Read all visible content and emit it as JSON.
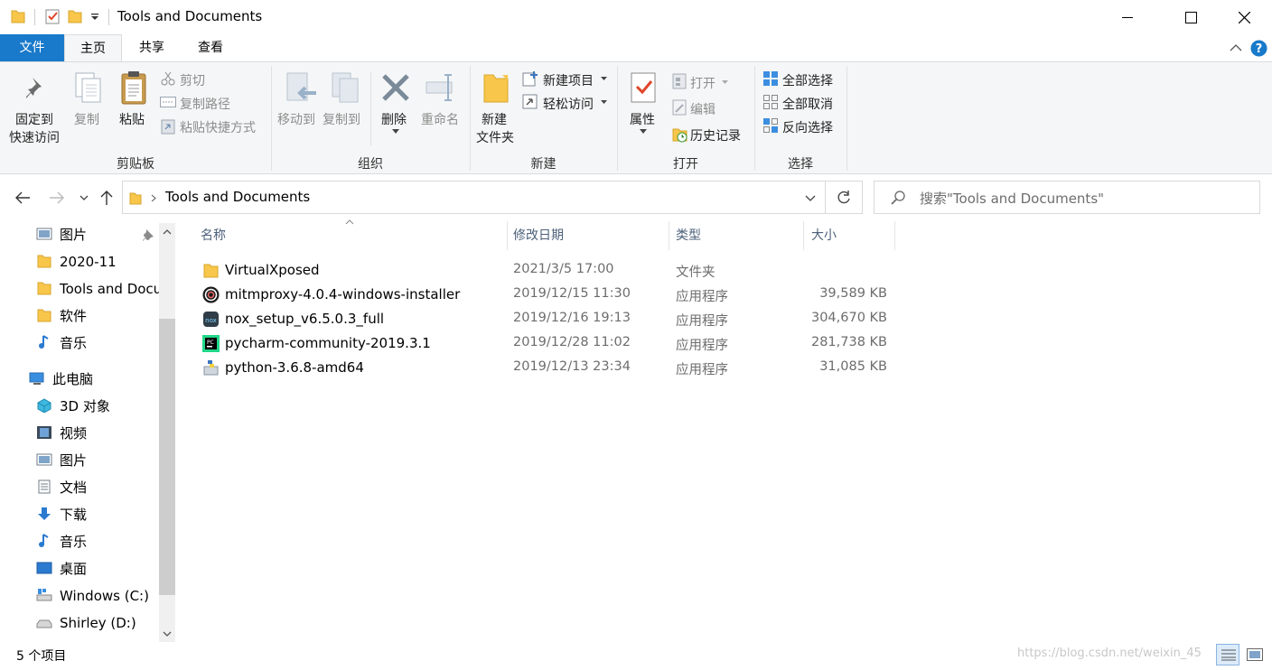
{
  "window": {
    "title": "Tools and Documents"
  },
  "ribbon_tabs": [
    "文件",
    "主页",
    "共享",
    "查看"
  ],
  "ribbon": {
    "clipboard": {
      "pin_line1": "固定到",
      "pin_line2": "快速访问",
      "copy": "复制",
      "paste": "粘贴",
      "cut": "剪切",
      "copy_path": "复制路径",
      "paste_shortcut": "粘贴快捷方式",
      "label": "剪贴板"
    },
    "organize": {
      "move_to": "移动到",
      "copy_to": "复制到",
      "delete": "删除",
      "rename": "重命名",
      "label": "组织"
    },
    "new": {
      "new_folder_line1": "新建",
      "new_folder_line2": "文件夹",
      "new_item": "新建项目",
      "easy_access": "轻松访问",
      "label": "新建"
    },
    "open": {
      "properties": "属性",
      "open": "打开",
      "edit": "编辑",
      "history": "历史记录",
      "label": "打开"
    },
    "select": {
      "select_all": "全部选择",
      "select_none": "全部取消",
      "invert": "反向选择",
      "label": "选择"
    }
  },
  "address": {
    "path": "Tools and Documents",
    "search_placeholder": "搜索\"Tools and Documents\""
  },
  "nav": {
    "quick_access": [
      {
        "label": "图片",
        "icon": "pictures-icon"
      },
      {
        "label": "2020-11",
        "icon": "folder-icon"
      },
      {
        "label": "Tools and Docu",
        "icon": "folder-icon"
      },
      {
        "label": "软件",
        "icon": "folder-icon"
      },
      {
        "label": "音乐",
        "icon": "music-icon"
      }
    ],
    "this_pc": "此电脑",
    "pc_items": [
      {
        "label": "3D 对象",
        "icon": "3d-objects-icon"
      },
      {
        "label": "视频",
        "icon": "video-icon"
      },
      {
        "label": "图片",
        "icon": "pictures-icon"
      },
      {
        "label": "文档",
        "icon": "documents-icon"
      },
      {
        "label": "下载",
        "icon": "download-icon"
      },
      {
        "label": "音乐",
        "icon": "music-icon"
      },
      {
        "label": "桌面",
        "icon": "desktop-icon"
      },
      {
        "label": "Windows  (C:)",
        "icon": "drive-c-icon"
      },
      {
        "label": "Shirley (D:)",
        "icon": "drive-d-icon"
      }
    ]
  },
  "columns": {
    "name": "名称",
    "modified": "修改日期",
    "type": "类型",
    "size": "大小"
  },
  "files": [
    {
      "name": "VirtualXposed",
      "modified": "2021/3/5 17:00",
      "type": "文件夹",
      "size": "",
      "icon": "folder-icon"
    },
    {
      "name": "mitmproxy-4.0.4-windows-installer",
      "modified": "2019/12/15 11:30",
      "type": "应用程序",
      "size": "39,589 KB",
      "icon": "mitmproxy-icon"
    },
    {
      "name": "nox_setup_v6.5.0.3_full",
      "modified": "2019/12/16 19:13",
      "type": "应用程序",
      "size": "304,670 KB",
      "icon": "nox-icon"
    },
    {
      "name": "pycharm-community-2019.3.1",
      "modified": "2019/12/28 11:02",
      "type": "应用程序",
      "size": "281,738 KB",
      "icon": "pycharm-icon"
    },
    {
      "name": "python-3.6.8-amd64",
      "modified": "2019/12/13 23:34",
      "type": "应用程序",
      "size": "31,085 KB",
      "icon": "python-installer-icon"
    }
  ],
  "status": {
    "item_count": "5 个项目",
    "watermark": "https://blog.csdn.net/weixin_45"
  },
  "colors": {
    "file_tab": "#1979ca",
    "ribbon_bg": "#f5f6f7",
    "folder": "#f7c64a",
    "column_header": "#4c607a"
  }
}
